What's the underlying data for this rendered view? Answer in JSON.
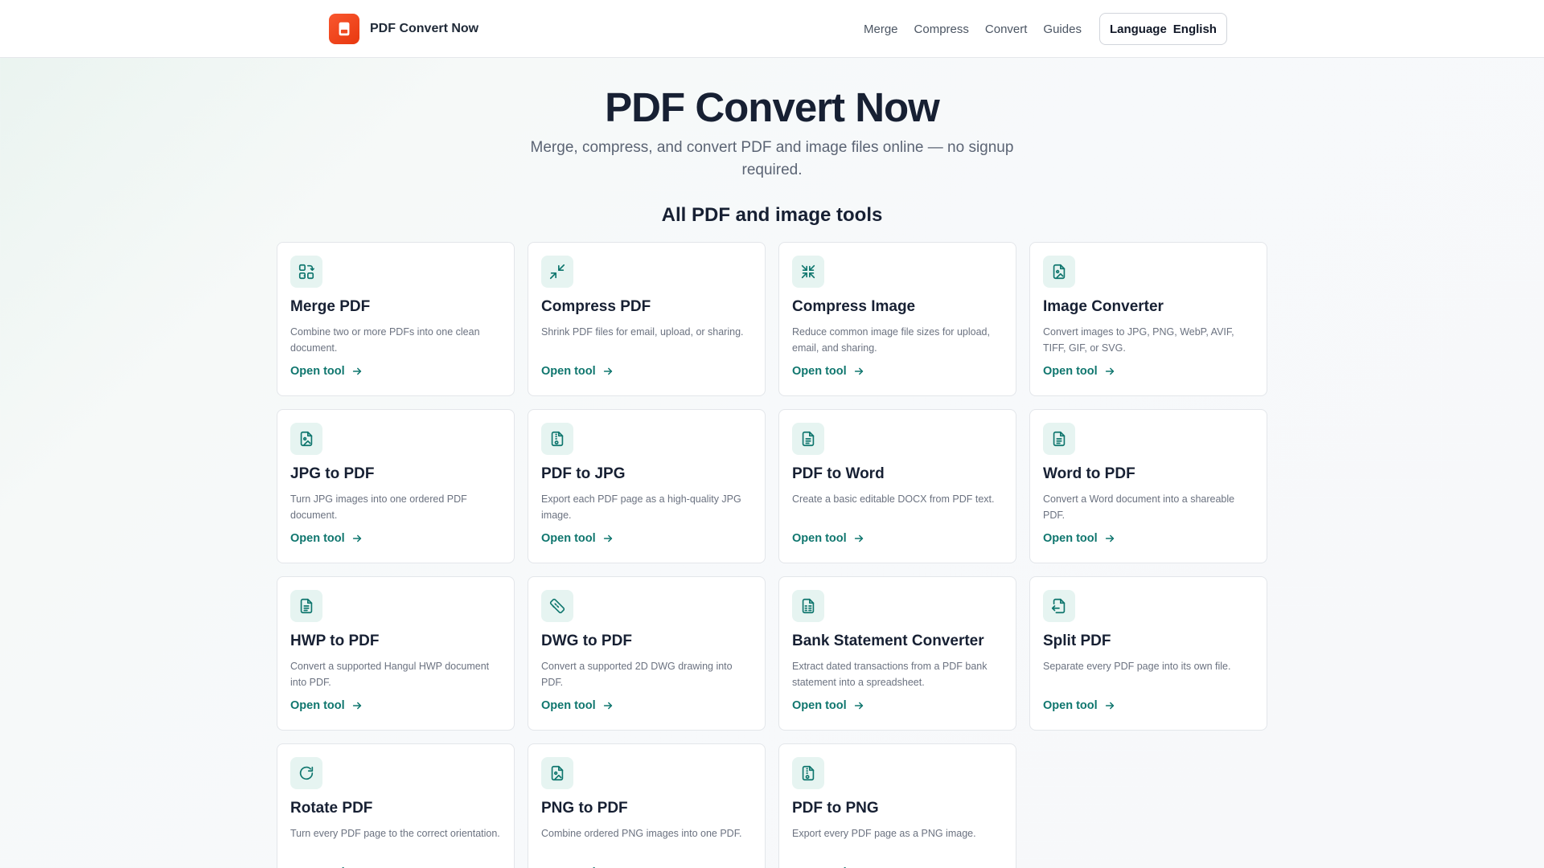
{
  "header": {
    "brand_name": "PDF Convert Now",
    "nav": [
      "Merge",
      "Compress",
      "Convert",
      "Guides"
    ],
    "language_label": "Language",
    "language_value": "English"
  },
  "hero": {
    "title": "PDF Convert Now",
    "subtitle": "Merge, compress, and convert PDF and image files online — no signup required."
  },
  "section_title": "All PDF and image tools",
  "tools": [
    {
      "title": "Merge PDF",
      "desc": "Combine two or more PDFs into one clean document.",
      "link": "Open tool",
      "icon": "merge-icon"
    },
    {
      "title": "Compress PDF",
      "desc": "Shrink PDF files for email, upload, or sharing.",
      "link": "Open tool",
      "icon": "shrink-arrows-icon"
    },
    {
      "title": "Compress Image",
      "desc": "Reduce common image file sizes for upload, email, and sharing.",
      "link": "Open tool",
      "icon": "compress-arrows-icon"
    },
    {
      "title": "Image Converter",
      "desc": "Convert images to JPG, PNG, WebP, AVIF, TIFF, GIF, or SVG.",
      "link": "Open tool",
      "icon": "file-image-icon"
    },
    {
      "title": "JPG to PDF",
      "desc": "Turn JPG images into one ordered PDF document.",
      "link": "Open tool",
      "icon": "file-image-icon"
    },
    {
      "title": "PDF to JPG",
      "desc": "Export each PDF page as a high-quality JPG image.",
      "link": "Open tool",
      "icon": "file-archive-icon"
    },
    {
      "title": "PDF to Word",
      "desc": "Create a basic editable DOCX from PDF text.",
      "link": "Open tool",
      "icon": "file-text-icon"
    },
    {
      "title": "Word to PDF",
      "desc": "Convert a Word document into a shareable PDF.",
      "link": "Open tool",
      "icon": "file-text-icon"
    },
    {
      "title": "HWP to PDF",
      "desc": "Convert a supported Hangul HWP document into PDF.",
      "link": "Open tool",
      "icon": "file-text-icon"
    },
    {
      "title": "DWG to PDF",
      "desc": "Convert a supported 2D DWG drawing into PDF.",
      "link": "Open tool",
      "icon": "ruler-icon"
    },
    {
      "title": "Bank Statement Converter",
      "desc": "Extract dated transactions from a PDF bank statement into a spreadsheet.",
      "link": "Open tool",
      "icon": "file-spreadsheet-icon"
    },
    {
      "title": "Split PDF",
      "desc": "Separate every PDF page into its own file.",
      "link": "Open tool",
      "icon": "file-output-icon"
    },
    {
      "title": "Rotate PDF",
      "desc": "Turn every PDF page to the correct orientation.",
      "link": "Open tool",
      "icon": "rotate-icon"
    },
    {
      "title": "PNG to PDF",
      "desc": "Combine ordered PNG images into one PDF.",
      "link": "Open tool",
      "icon": "file-image-icon"
    },
    {
      "title": "PDF to PNG",
      "desc": "Export every PDF page as a PNG image.",
      "link": "Open tool",
      "icon": "file-archive-icon"
    }
  ],
  "colors": {
    "accent": "#0f766e",
    "icon_bg": "#e6f4f1",
    "brand": "#f04b22"
  }
}
